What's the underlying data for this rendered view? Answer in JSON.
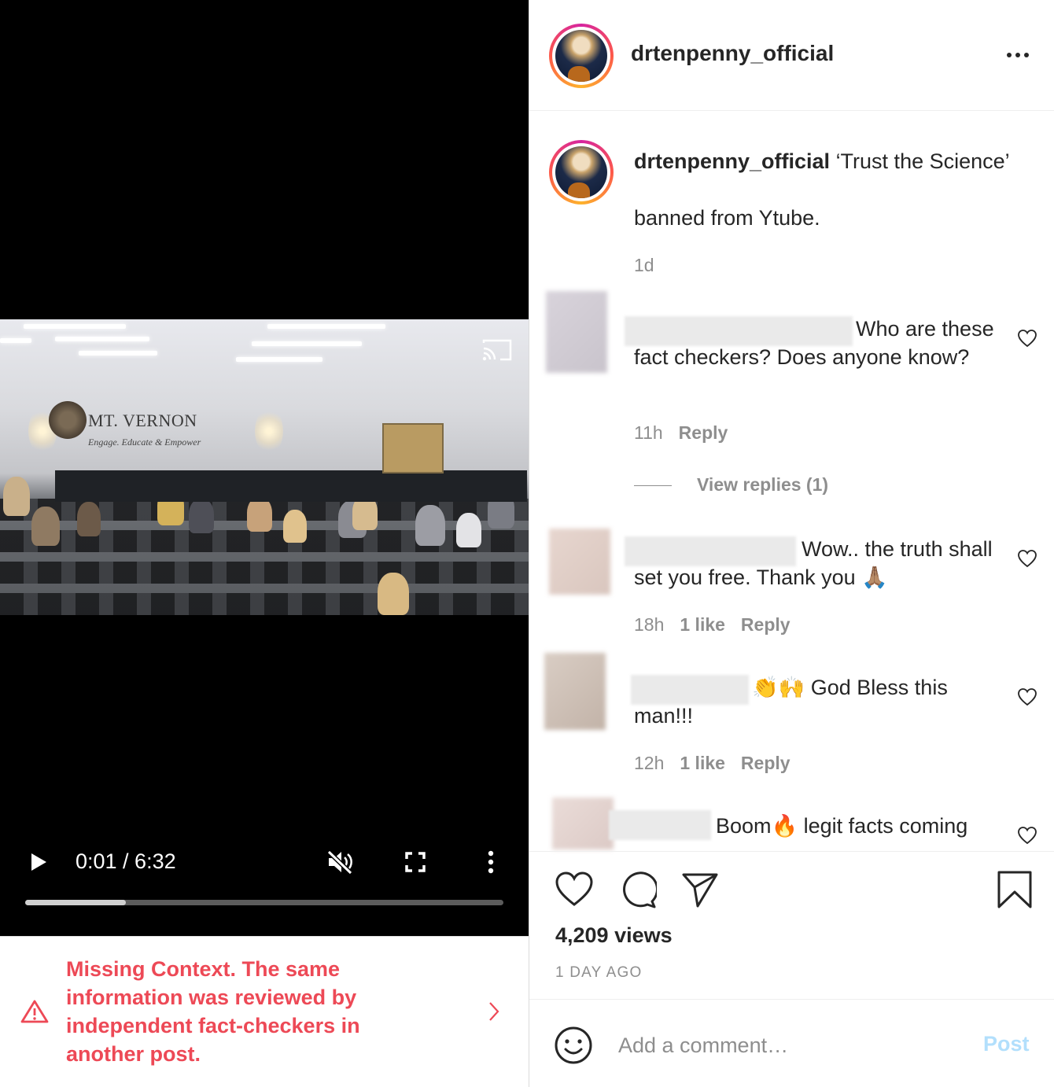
{
  "video": {
    "wall_title": "MT. VERNON",
    "wall_tagline": "Engage. Educate & Empower",
    "time": "0:01 / 6:32",
    "progress": 0.21
  },
  "factcheck": {
    "text": "Missing Context. The same information was reviewed by independent fact-checkers in another post.",
    "color": "#ed4956"
  },
  "header": {
    "username": "drtenpenny_official"
  },
  "caption": {
    "username": "drtenpenny_official",
    "text_line1": "‘Trust the Science’",
    "text_line2": "banned from Ytube.",
    "time": "1d"
  },
  "comments": [
    {
      "text": "Who are these fact checkers? Does anyone know?",
      "time": "11h",
      "likes": "",
      "reply": "Reply",
      "view_replies": "View replies (1)"
    },
    {
      "text": "Wow.. the truth shall set you free. Thank you 🙏🏽",
      "time": "18h",
      "likes": "1 like",
      "reply": "Reply"
    },
    {
      "text": "👏🙌 God Bless this man!!!",
      "time": "12h",
      "likes": "1 like",
      "reply": "Reply"
    },
    {
      "text": "Boom🔥 legit facts coming"
    }
  ],
  "stats": {
    "views": "4,209 views",
    "age": "1 DAY AGO"
  },
  "compose": {
    "placeholder": "Add a comment…",
    "post_label": "Post",
    "post_color": "#b2dffc"
  },
  "icons": [
    "play-icon",
    "mute-icon",
    "fullscreen-icon",
    "more-vertical-icon",
    "cast-icon",
    "warning-icon",
    "chevron-right-icon",
    "more-horizontal-icon",
    "heart-icon",
    "comment-icon",
    "share-icon",
    "bookmark-icon",
    "emoji-icon"
  ]
}
